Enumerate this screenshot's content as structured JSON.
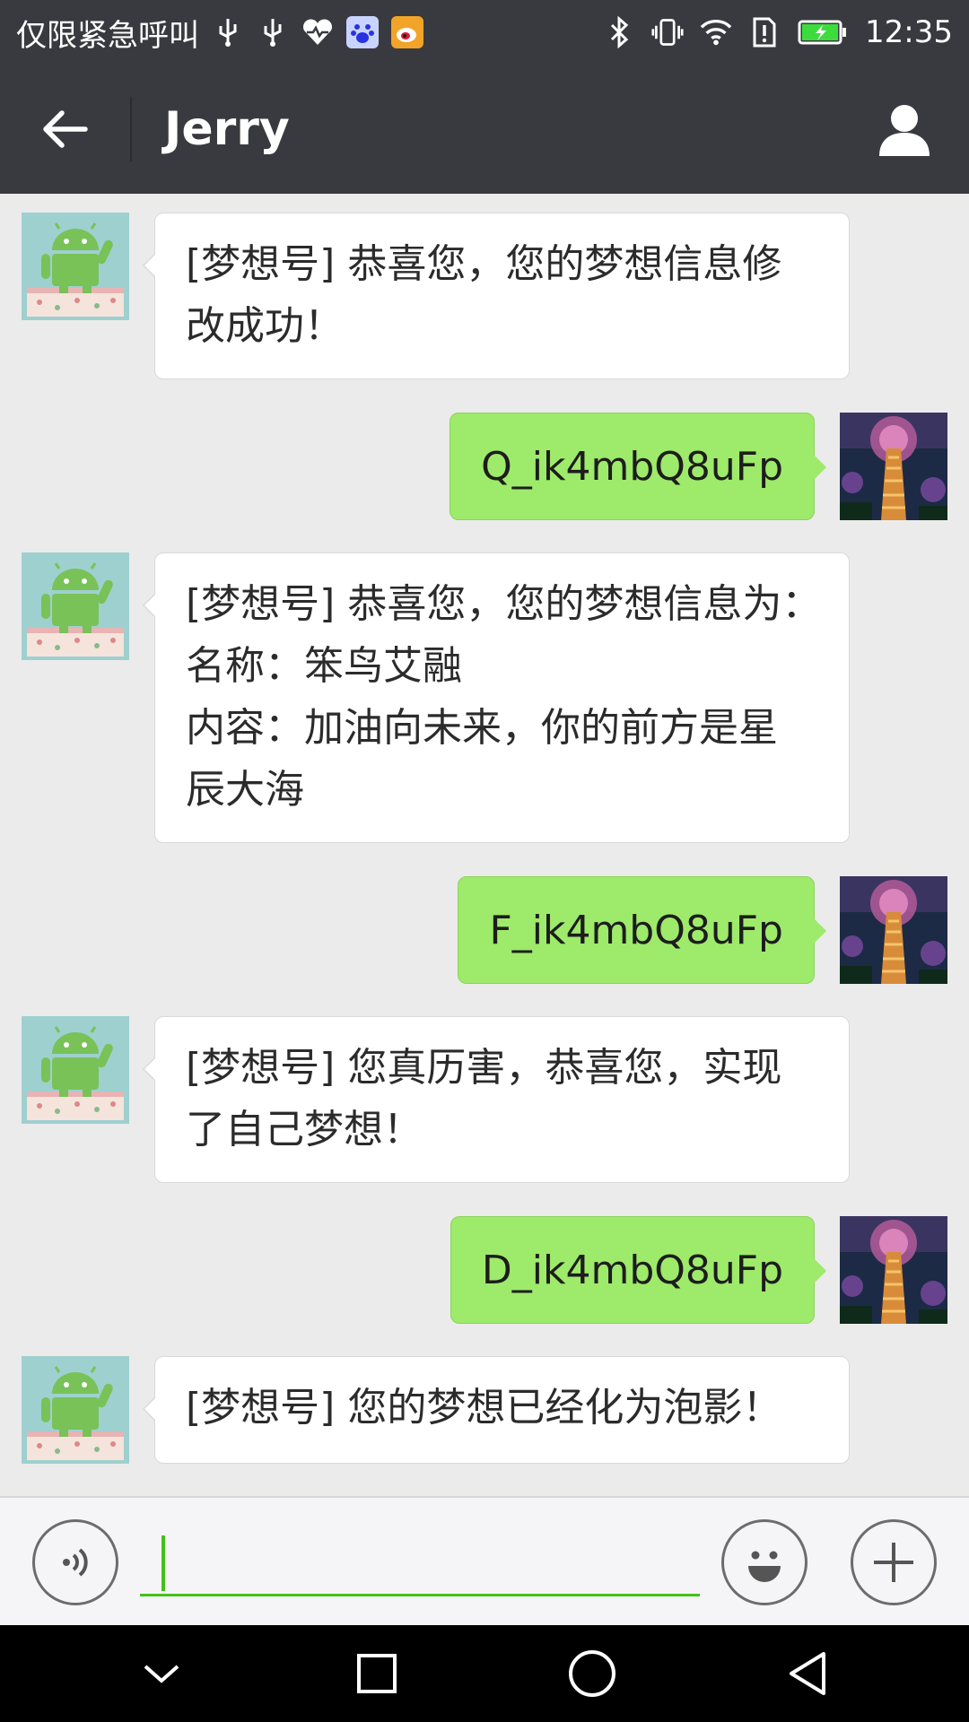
{
  "status_bar": {
    "carrier_text": "仅限紧急呼叫",
    "time": "12:35"
  },
  "header": {
    "title": "Jerry"
  },
  "messages": [
    {
      "side": "in",
      "text": "[梦想号] 恭喜您，您的梦想信息修\n改成功！"
    },
    {
      "side": "out",
      "text": "Q_ik4mbQ8uFp"
    },
    {
      "side": "in",
      "text": "[梦想号] 恭喜您，您的梦想信息为：\n名称：笨鸟艾融\n内容：加油向未来，你的前方是星\n辰大海"
    },
    {
      "side": "out",
      "text": "F_ik4mbQ8uFp"
    },
    {
      "side": "in",
      "text": "[梦想号] 您真历害，恭喜您，实现\n了自己梦想！"
    },
    {
      "side": "out",
      "text": "D_ik4mbQ8uFp"
    },
    {
      "side": "in",
      "text": "[梦想号] 您的梦想已经化为泡影！"
    }
  ],
  "input": {
    "value": ""
  },
  "icons": {
    "back": "arrow-left-icon",
    "profile": "person-icon",
    "voice": "voice-icon",
    "emoji": "smiley-icon",
    "plus": "plus-icon"
  },
  "colors": {
    "header_bg": "#393a3f",
    "chat_bg": "#ebebeb",
    "out_bubble": "#9eea6a",
    "in_bubble": "#ffffff",
    "accent": "#45c01a"
  }
}
